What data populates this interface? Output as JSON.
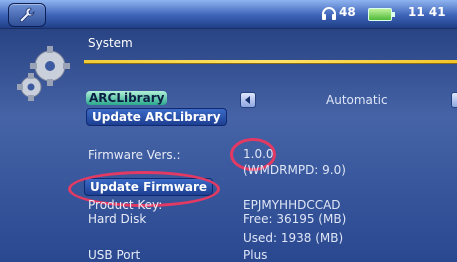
{
  "header": {
    "volume": "48",
    "time": "11 41",
    "icons": [
      "wrench-icon",
      "headphones-icon",
      "battery-icon"
    ]
  },
  "section": {
    "title": "System",
    "icon": "gears-icon"
  },
  "arc_library": {
    "label": "ARCLibrary",
    "value": "Automatic",
    "update_label": "Update ARCLibrary"
  },
  "firmware": {
    "label": "Firmware Vers.:",
    "version": "1.0.0",
    "wmdrmpd": "(WMDRMPD: 9.0)",
    "update_label": "Update Firmware"
  },
  "product_key": {
    "label": "Product Key:",
    "value": "EPJMYHHDCCAD"
  },
  "hard_disk": {
    "label": "Hard Disk",
    "free": "Free: 36195 (MB)",
    "used": "Used:  1938 (MB)"
  },
  "usb_port": {
    "label": "USB Port",
    "value": "Plus"
  },
  "colors": {
    "accent_yellow": "#f3c52a",
    "highlight_circle": "#e23a63",
    "button_blue": "#2a55b0",
    "background_blue": "#3553a0"
  }
}
